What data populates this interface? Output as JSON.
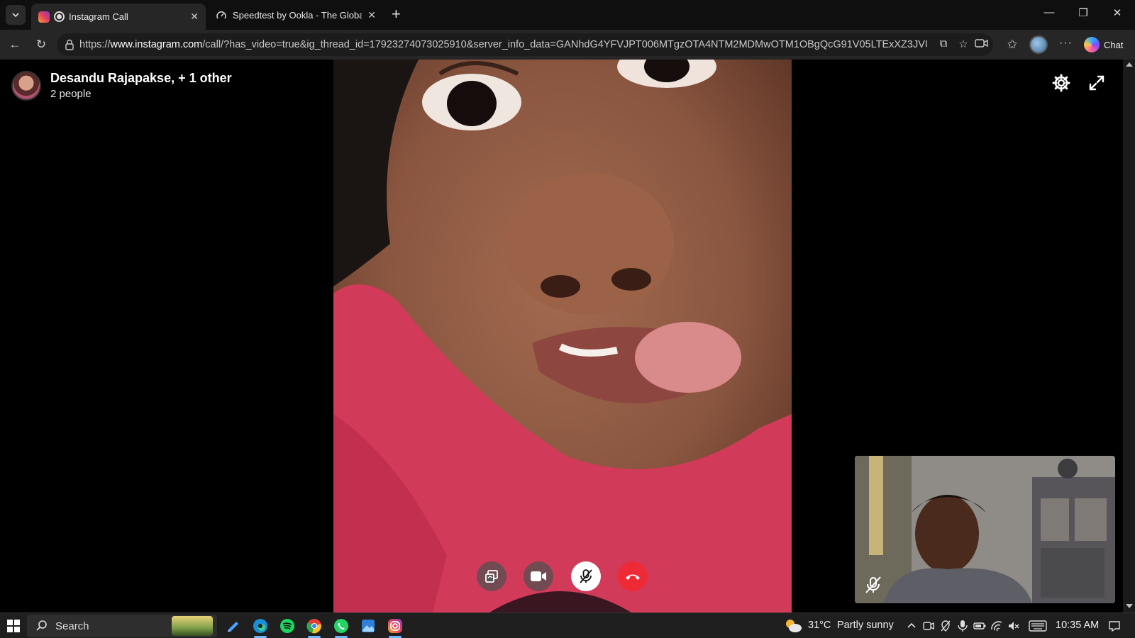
{
  "browser": {
    "tabs": [
      {
        "title": "Instagram Call",
        "active": true
      },
      {
        "title": "Speedtest by Ookla - The Global B",
        "active": false
      }
    ],
    "url_prefix": "https://",
    "url_domain": "www.instagram.com",
    "url_rest": "/call/?has_video=true&ig_thread_id=17923274073025910&server_info_data=GANhdG4YFVJPT006MTgzOTA4NTM2MDMwOTM1OBgQcG91V05LTExXZ3JVUG...",
    "chat_label": "Chat"
  },
  "call": {
    "title": "Desandu Rajapakse, + 1 other",
    "subtitle": "2 people"
  },
  "taskbar": {
    "search_label": "Search",
    "temperature": "31°C",
    "weather": "Partly sunny",
    "time": "10:35 AM"
  },
  "colors": {
    "end_call": "#ee2a36",
    "browser_bg": "#262626",
    "tab_strip": "#0f0f0f"
  }
}
